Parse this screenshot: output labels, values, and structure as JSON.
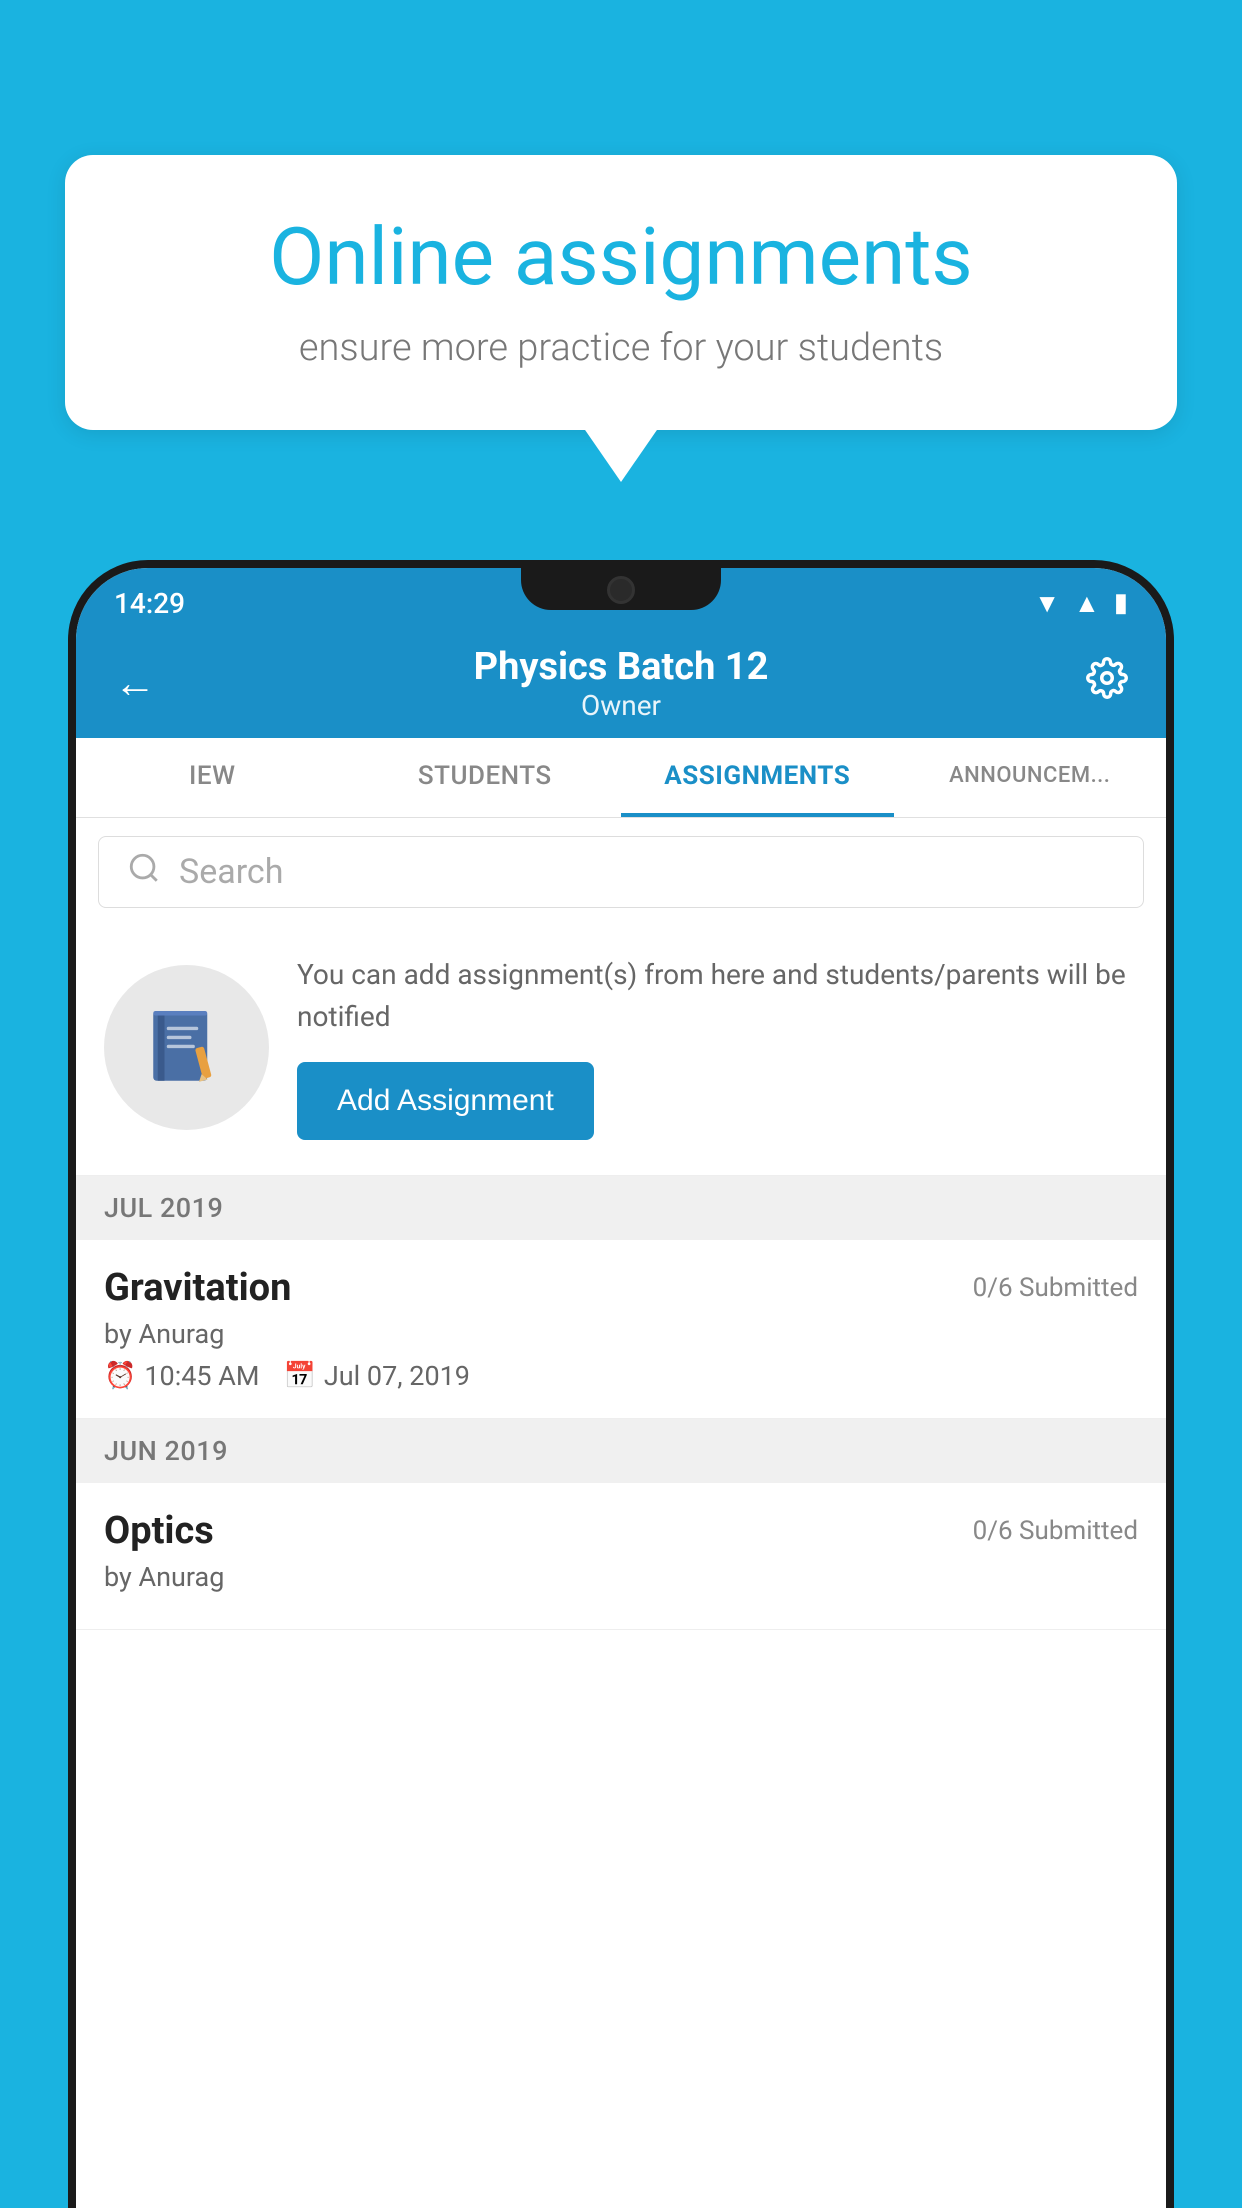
{
  "background_color": "#1ab3e0",
  "speech_bubble": {
    "title": "Online assignments",
    "subtitle": "ensure more practice for your students"
  },
  "status_bar": {
    "time": "14:29",
    "icons": [
      "wifi",
      "signal",
      "battery"
    ]
  },
  "header": {
    "title": "Physics Batch 12",
    "subtitle": "Owner"
  },
  "tabs": [
    {
      "label": "IEW",
      "active": false
    },
    {
      "label": "STUDENTS",
      "active": false
    },
    {
      "label": "ASSIGNMENTS",
      "active": true
    },
    {
      "label": "ANNOUNCEM...",
      "active": false
    }
  ],
  "search": {
    "placeholder": "Search"
  },
  "info_card": {
    "description": "You can add assignment(s) from here and students/parents will be notified",
    "button_label": "Add Assignment"
  },
  "sections": [
    {
      "label": "JUL 2019",
      "assignments": [
        {
          "title": "Gravitation",
          "submitted": "0/6 Submitted",
          "by": "by Anurag",
          "time": "10:45 AM",
          "date": "Jul 07, 2019"
        }
      ]
    },
    {
      "label": "JUN 2019",
      "assignments": [
        {
          "title": "Optics",
          "submitted": "0/6 Submitted",
          "by": "by Anurag",
          "time": "",
          "date": ""
        }
      ]
    }
  ]
}
